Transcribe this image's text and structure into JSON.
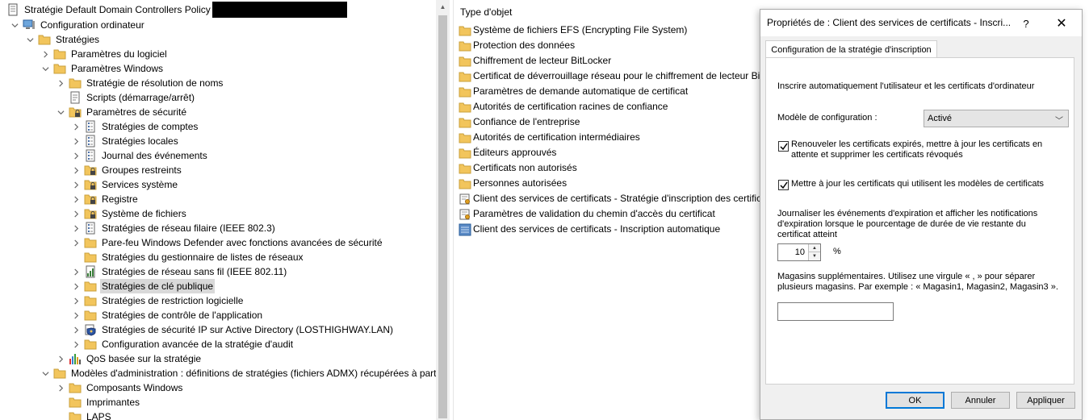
{
  "tree": {
    "root_label": "Stratégie Default Domain Controllers Policy",
    "items": [
      {
        "label": "Configuration ordinateur"
      },
      {
        "label": "Stratégies"
      },
      {
        "label": "Paramètres du logiciel"
      },
      {
        "label": "Paramètres Windows"
      },
      {
        "label": "Stratégie de résolution de noms"
      },
      {
        "label": "Scripts (démarrage/arrêt)"
      },
      {
        "label": "Paramètres de sécurité"
      },
      {
        "label": "Stratégies de comptes"
      },
      {
        "label": "Stratégies locales"
      },
      {
        "label": "Journal des événements"
      },
      {
        "label": "Groupes restreints"
      },
      {
        "label": "Services système"
      },
      {
        "label": "Registre"
      },
      {
        "label": "Système de fichiers"
      },
      {
        "label": "Stratégies de réseau filaire (IEEE 802.3)"
      },
      {
        "label": "Pare-feu Windows Defender avec fonctions avancées de sécurité"
      },
      {
        "label": "Stratégies du gestionnaire de listes de réseaux"
      },
      {
        "label": "Stratégies de réseau sans fil (IEEE 802.11)"
      },
      {
        "label": "Stratégies de clé publique"
      },
      {
        "label": "Stratégies de restriction logicielle"
      },
      {
        "label": "Stratégies de contrôle de l'application"
      },
      {
        "label": "Stratégies de sécurité IP sur Active Directory (LOSTHIGHWAY.LAN)"
      },
      {
        "label": "Configuration avancée de la stratégie d'audit"
      },
      {
        "label": "QoS basée sur la stratégie"
      },
      {
        "label": "Modèles d'administration : définitions de stratégies (fichiers ADMX) récupérées à parti"
      },
      {
        "label": "Composants Windows"
      },
      {
        "label": "Imprimantes"
      },
      {
        "label": "LAPS"
      }
    ]
  },
  "list": {
    "header": "Type d'objet",
    "items": [
      {
        "label": "Système de fichiers EFS (Encrypting File System)"
      },
      {
        "label": "Protection des données"
      },
      {
        "label": "Chiffrement de lecteur BitLocker"
      },
      {
        "label": "Certificat de déverrouillage réseau pour le chiffrement de lecteur Bit"
      },
      {
        "label": "Paramètres de demande automatique de certificat"
      },
      {
        "label": "Autorités de certification racines de confiance"
      },
      {
        "label": "Confiance de l'entreprise"
      },
      {
        "label": "Autorités de certification intermédiaires"
      },
      {
        "label": "Éditeurs approuvés"
      },
      {
        "label": "Certificats non autorisés"
      },
      {
        "label": "Personnes autorisées"
      },
      {
        "label": "Client des services de certificats - Stratégie d'inscription des certifica"
      },
      {
        "label": "Paramètres de validation du chemin d'accès du certificat"
      },
      {
        "label": "Client des services de certificats - Inscription automatique"
      }
    ]
  },
  "dialog": {
    "title": "Propriétés de : Client des services de certificats - Inscri...",
    "help_label": "?",
    "close_label": "✕",
    "tab_label": "Configuration de la stratégie d'inscription",
    "intro": "Inscrire automatiquement l'utilisateur et les certificats d'ordinateur",
    "model_label": "Modèle de configuration :",
    "model_value": "Activé",
    "renew_line1": "Renouveler les certificats expirés, mettre à jour les certificats en",
    "renew_line2": "attente et supprimer les certificats révoqués",
    "update_label": "Mettre à jour les certificats qui utilisent les modèles de certificats",
    "log_line1": "Journaliser les événements d'expiration et afficher les notifications",
    "log_line2": "d'expiration lorsque le pourcentage de durée de vie restante du",
    "log_line3": "certificat atteint",
    "percent_value": "10",
    "percent_unit": "%",
    "stores_line1": "Magasins supplémentaires. Utilisez une virgule « , » pour séparer",
    "stores_line2": "plusieurs magasins. Par exemple : « Magasin1, Magasin2, Magasin3 ».",
    "stores_value": "",
    "ok_label": "OK",
    "cancel_label": "Annuler",
    "apply_label": "Appliquer",
    "renew_checked": true,
    "update_checked": true
  },
  "colors": {
    "folder": "#f2c55c",
    "selected_row": "#d9d9d9",
    "dialog_bg": "#f0f0f0",
    "primary_border": "#0078d7"
  }
}
